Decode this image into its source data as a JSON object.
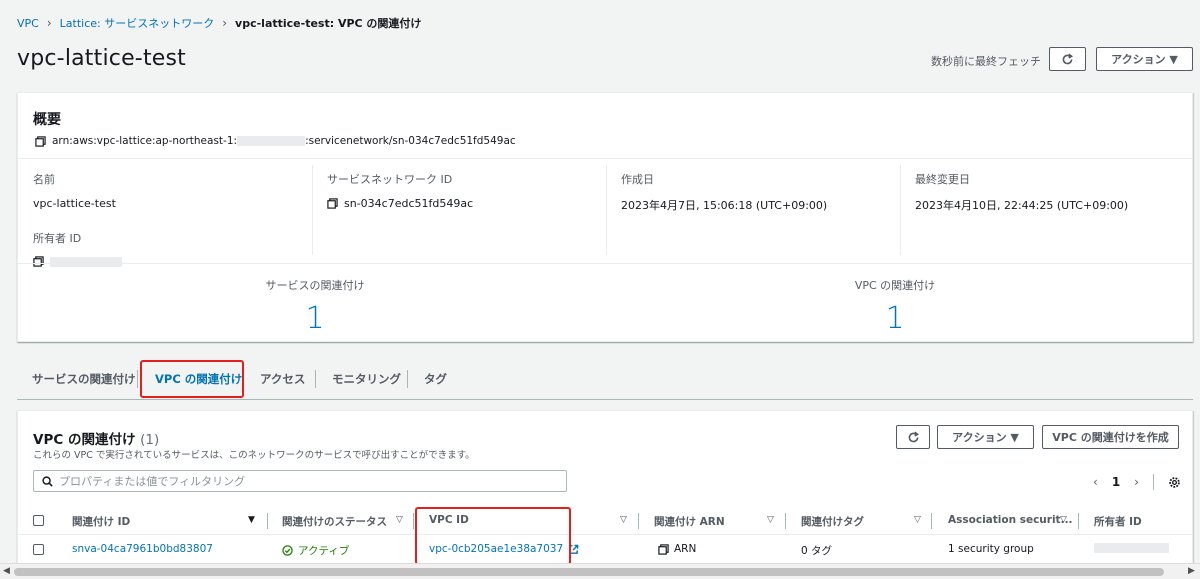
{
  "breadcrumb": {
    "items": [
      "VPC",
      "Lattice: サービスネットワーク"
    ],
    "current": "vpc-lattice-test: VPC の関連付け"
  },
  "header": {
    "title": "vpc-lattice-test",
    "fetch_status": "数秒前に最終フェッチ",
    "actions_label": "アクション ▼"
  },
  "summary": {
    "title": "概要",
    "arn_prefix": "arn:aws:vpc-lattice:ap-northeast-1:",
    "arn_suffix": ":servicenetwork/sn-034c7edc51fd549ac",
    "name_label": "名前",
    "name_value": "vpc-lattice-test",
    "owner_label": "所有者 ID",
    "sn_id_label": "サービスネットワーク ID",
    "sn_id_value": "sn-034c7edc51fd549ac",
    "created_label": "作成日",
    "created_value": "2023年4月7日, 15:06:18 (UTC+09:00)",
    "modified_label": "最終変更日",
    "modified_value": "2023年4月10日, 22:44:25 (UTC+09:00)",
    "service_assoc_label": "サービスの関連付け",
    "service_assoc_count": "1",
    "vpc_assoc_label": "VPC の関連付け",
    "vpc_assoc_count": "1"
  },
  "tabs": [
    {
      "label": "サービスの関連付け"
    },
    {
      "label": "VPC の関連付け"
    },
    {
      "label": "アクセス"
    },
    {
      "label": "モニタリング"
    },
    {
      "label": "タグ"
    }
  ],
  "vpc_table": {
    "title": "VPC の関連付け",
    "count": "(1)",
    "description": "これらの VPC で実行されているサービスは、このネットワークのサービスで呼び出すことができます。",
    "actions_label": "アクション ▼",
    "create_label": "VPC の関連付けを作成",
    "search_placeholder": "プロパティまたは値でフィルタリング",
    "page": "1",
    "columns": [
      "関連付け ID",
      "関連付けのステータス",
      "VPC ID",
      "関連付け ARN",
      "関連付けタグ",
      "Association securit...",
      "所有者 ID"
    ],
    "row": {
      "assoc_id": "snva-04ca7961b0bd83807",
      "status": "アクティブ",
      "vpc_id": "vpc-0cb205ae1e38a7037",
      "arn": "ARN",
      "tags": "0 タグ",
      "security": "1 security group"
    }
  },
  "colors": {
    "link": "#0073bb",
    "success": "#1d8102",
    "highlight": "#e0201c"
  }
}
